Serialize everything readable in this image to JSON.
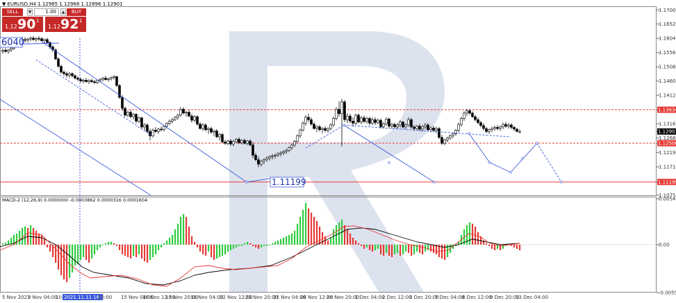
{
  "header": {
    "arrow": "▼",
    "symbol": "EURUSD,H4",
    "ohlc": "1.12965 1.12968 1.12896 1.12901"
  },
  "trade_panel": {
    "sell_label": "SELL",
    "buy_label": "BUY",
    "volume": "1.00",
    "sell_price_small": "1.12",
    "sell_price_big": "90",
    "sell_price_sup": "1",
    "buy_price_small": "1.12",
    "buy_price_big": "92",
    "buy_price_sup": "1",
    "color": "#c62828"
  },
  "price_axis": {
    "ticks": [
      "1.17000",
      "1.16525",
      "1.16040",
      "1.15560",
      "1.15080",
      "1.14600",
      "1.14120",
      "1.13634",
      "1.13160",
      "1.12901",
      "1.12680",
      "1.12506",
      "1.12195",
      "1.11710",
      "1.11199",
      "1.10750"
    ],
    "highlighted": {
      "1.13634": "#e53935",
      "1.12901": "#000000",
      "1.12506": "#e53935",
      "1.11199": "#e53935"
    }
  },
  "annotations": {
    "left_level": "6040",
    "bottom_level": "1.11199"
  },
  "time_axis": {
    "labels": [
      "5 Nov 2021",
      "9 Nov 04:00",
      "10 N",
      "2021.11.11 16:00",
      "20:00",
      "15 Nov 04:00",
      "16 Nov 12:00",
      "17 Nov 20:00",
      "19 Nov 04:00",
      "22 Nov 12:00",
      "23 Nov 20:00",
      "25 Nov 04:00",
      "26 Nov 12:00",
      "29 Nov 20:00",
      "1 Dec 04:00",
      "2 Dec 12:00",
      "3 Dec 20:00",
      "7 Dec 04:00",
      "8 Dec 12:00",
      "9 Dec 20:00",
      "13 Dec 04:00"
    ]
  },
  "macd": {
    "header": "MACD-2 (12,26,9) 0.0000000 -0.0003862 0.0000316 0.0001604",
    "ticks": [
      "0.0054153",
      "0.00",
      "-0.0055516"
    ]
  },
  "watermark_color": "#dde3ee"
}
